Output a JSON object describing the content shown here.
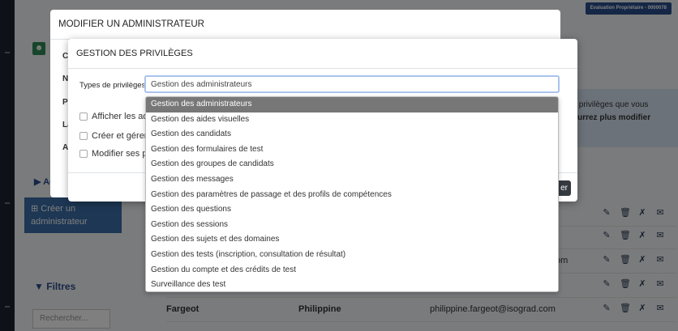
{
  "license_badge": "Evaluation Propriétaire - 0000078",
  "info_box": {
    "line1": "s privilèges que vous",
    "line2": "ourrez plus modifier"
  },
  "sidebar": {
    "section_title": "Ad",
    "create_admin_label": "Créer un administrateur",
    "filters_title": "Filtres",
    "search_placeholder": "Rechercher..."
  },
  "table": {
    "rows": [
      {
        "last": "",
        "first": "",
        "email": ""
      },
      {
        "last": "",
        "first": "",
        "email": ""
      },
      {
        "last": "",
        "first": "",
        "email": "om"
      },
      {
        "last": "",
        "first": "",
        "email": ""
      },
      {
        "last": "Fargeot",
        "first": "Philippine",
        "email": "philippine.fargeot@isograd.com"
      }
    ]
  },
  "outer_modal": {
    "title": "MODIFIER UN ADMINISTRATEUR",
    "labels": [
      "C",
      "N",
      "Pr",
      "La",
      "A"
    ]
  },
  "inner_modal": {
    "title": "GESTION DES PRIVILÈGES",
    "types_label": "Types de privilèges",
    "selected_value": "Gestion des administrateurs",
    "checkboxes": [
      "Afficher les adm",
      "Créer et gérer d",
      "Modifier ses pri"
    ],
    "save_label": "er"
  },
  "dropdown": {
    "options": [
      "Gestion des administrateurs",
      "Gestion des aides visuelles",
      "Gestion des candidats",
      "Gestion des formulaires de test",
      "Gestion des groupes de candidats",
      "Gestion des messages",
      "Gestion des paramètres de passage et des profils de compétences",
      "Gestion des questions",
      "Gestion des sessions",
      "Gestion des sujets et des domaines",
      "Gestion des tests (inscription, consultation de résultat)",
      "Gestion du compte et des crédits de test",
      "Surveillance des test"
    ],
    "selected_index": 0
  }
}
